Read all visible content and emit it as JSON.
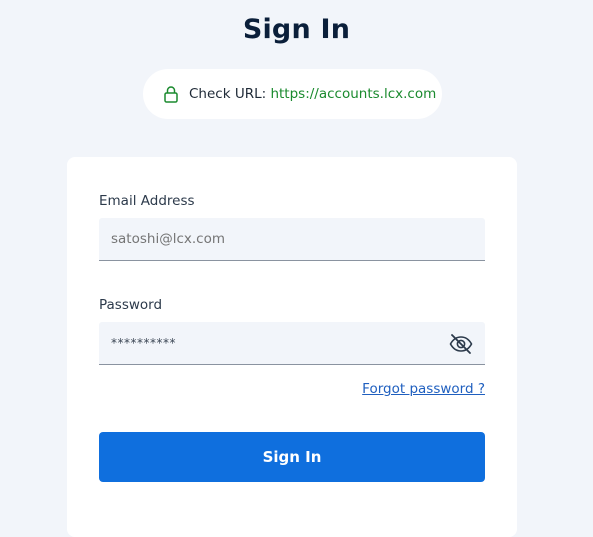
{
  "page": {
    "title": "Sign In"
  },
  "url_check": {
    "icon": "lock-icon",
    "label": "Check URL: ",
    "url": "https://accounts.lcx.com",
    "url_color": "#1a8a2e"
  },
  "form": {
    "email": {
      "label": "Email Address",
      "placeholder": "satoshi@lcx.com",
      "value": ""
    },
    "password": {
      "label": "Password",
      "masked_value": "**********",
      "toggle_icon": "eye-slash-icon"
    },
    "forgot_password": "Forgot password ?",
    "submit_label": "Sign In",
    "accent_color": "#0f6fde"
  }
}
